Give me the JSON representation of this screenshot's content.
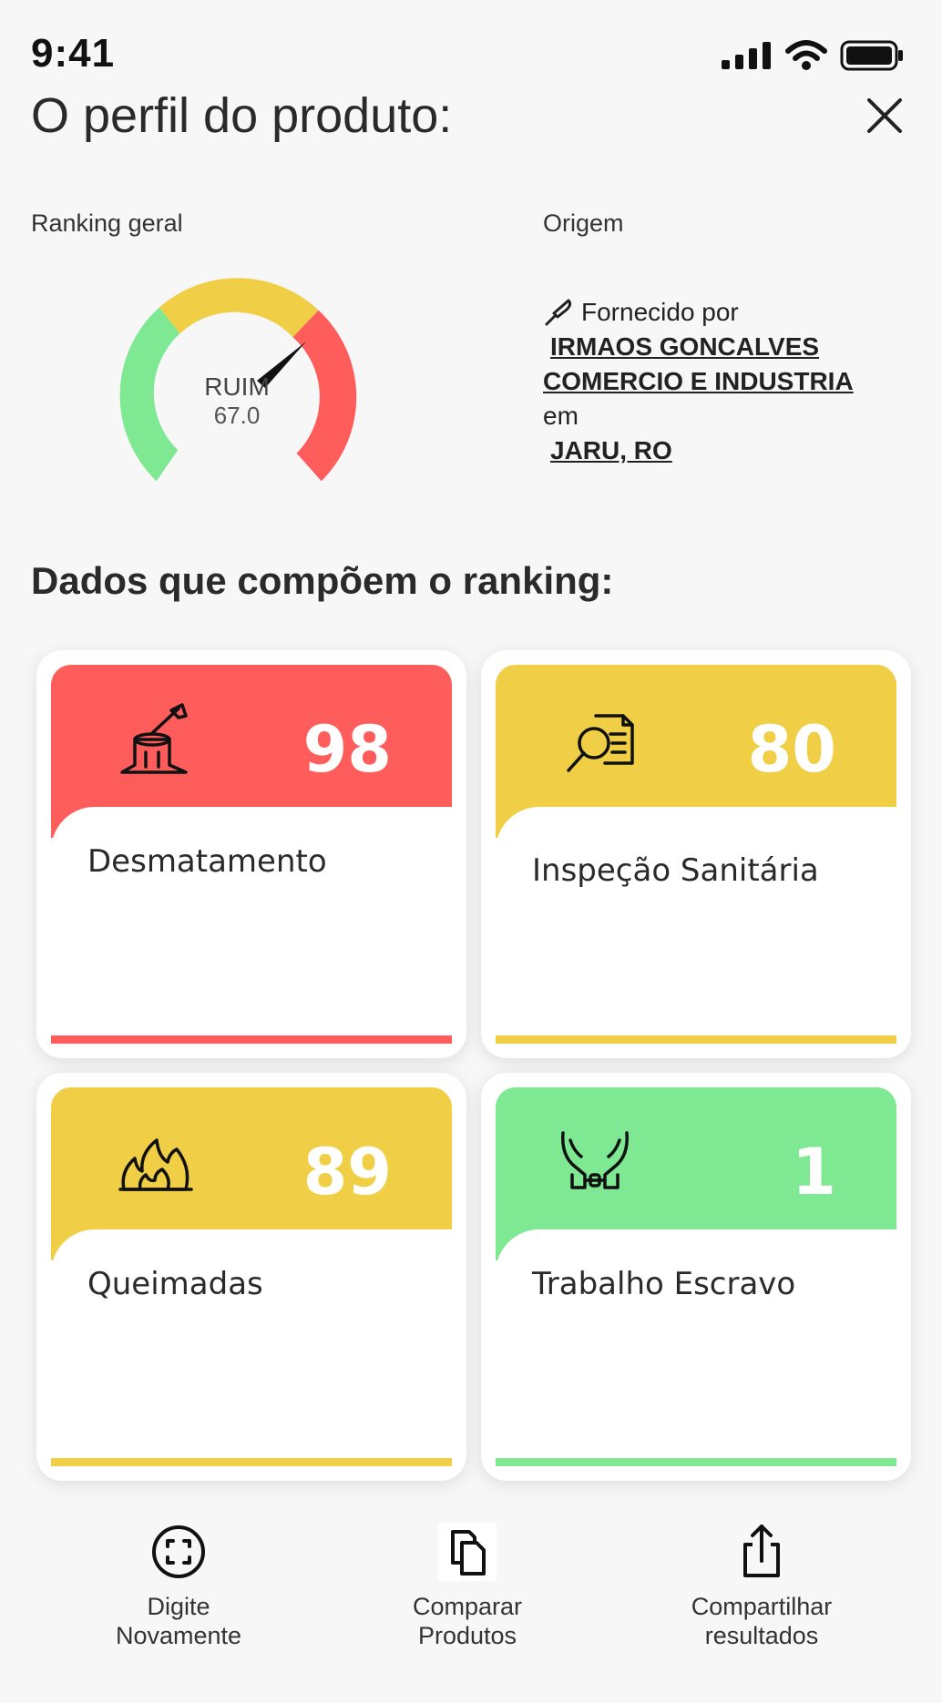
{
  "status": {
    "time": "9:41",
    "icons": [
      "signal-icon",
      "wifi-icon",
      "battery-icon"
    ]
  },
  "header": {
    "title": "O perfil do produto:",
    "close_icon": "close-icon"
  },
  "ranking": {
    "label": "Ranking geral",
    "rating": "RUIM",
    "score": "67.0",
    "score_value": 67.0
  },
  "origin": {
    "label": "Origem",
    "provided_by": "Fornecido por",
    "supplier_line1": "IRMAOS GONCALVES",
    "supplier_line2": "COMERCIO E INDUSTRIA",
    "in_word": "em",
    "location": "JARU, RO"
  },
  "section_title": "Dados que compõem o ranking:",
  "cards": [
    {
      "label": "Desmatamento",
      "value": "98",
      "color": "#ff5c5c",
      "icon": "tree-stump-axe-icon"
    },
    {
      "label": "Inspeção Sanitária",
      "value": "80",
      "color": "#f0cf46",
      "icon": "magnifier-document-icon"
    },
    {
      "label": "Queimadas",
      "value": "89",
      "color": "#f0cf46",
      "icon": "fire-icon"
    },
    {
      "label": "Trabalho Escravo",
      "value": "1",
      "color": "#7ee892",
      "icon": "chained-hands-icon"
    }
  ],
  "actions": [
    {
      "line1": "Digite",
      "line2": "Novamente",
      "icon": "scan-face-icon"
    },
    {
      "line1": "Comparar",
      "line2": "Produtos",
      "icon": "copy-documents-icon"
    },
    {
      "line1": "Compartilhar",
      "line2": "resultados",
      "icon": "share-icon"
    }
  ],
  "colors": {
    "red": "#ff5c5c",
    "yellow": "#f0cf46",
    "green": "#7ee892"
  }
}
